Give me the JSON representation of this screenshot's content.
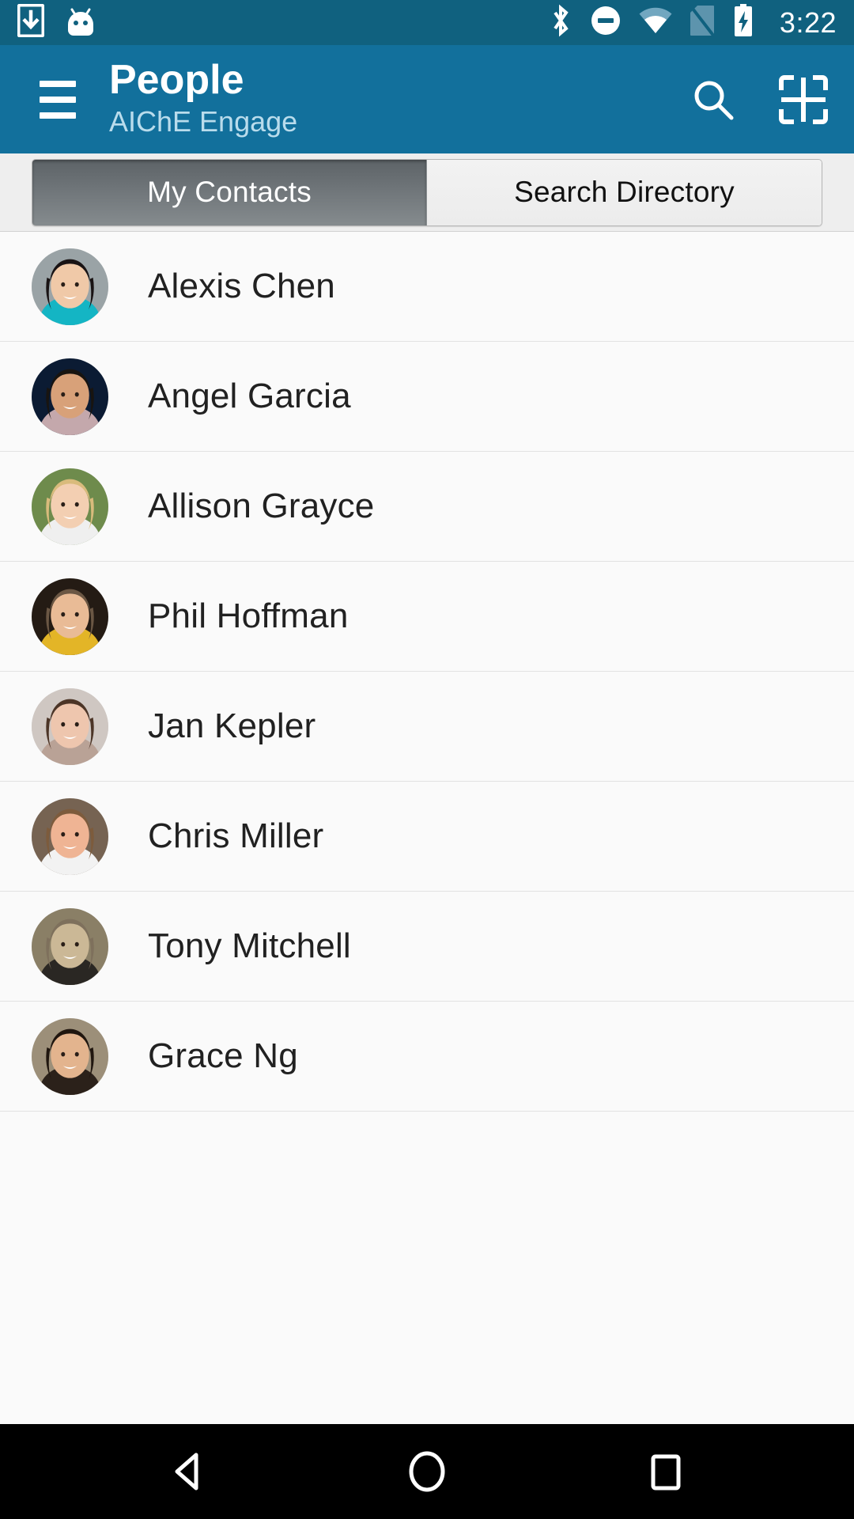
{
  "status_bar": {
    "background_color": "#10617f",
    "time": "3:22",
    "left_icons": [
      {
        "name": "download-icon",
        "glyph": "download"
      },
      {
        "name": "android-head-icon",
        "glyph": "android"
      }
    ],
    "right_icons": [
      {
        "name": "bluetooth-icon",
        "glyph": "bluetooth"
      },
      {
        "name": "do-not-disturb-icon",
        "glyph": "dnd"
      },
      {
        "name": "wifi-icon",
        "glyph": "wifi"
      },
      {
        "name": "no-sim-icon",
        "glyph": "no-sim"
      },
      {
        "name": "battery-charging-icon",
        "glyph": "battery-charging"
      }
    ]
  },
  "app_bar": {
    "background_color": "#12709c",
    "title": "People",
    "subtitle": "AIChE Engage",
    "menu_icon": "hamburger-menu-icon",
    "actions": [
      {
        "name": "search-icon",
        "label": "Search"
      },
      {
        "name": "grid-view-icon",
        "label": "Grid"
      }
    ]
  },
  "tabs": {
    "selected_index": 0,
    "items": [
      {
        "label": "My Contacts",
        "selected": true
      },
      {
        "label": "Search Directory",
        "selected": false
      }
    ]
  },
  "contacts": [
    {
      "name": "Alexis Chen",
      "avatar_skin": "#f0c9a8",
      "avatar_hair": "#191314",
      "avatar_bg": "#9aa3a6",
      "avatar_shirt": "#14b5c4"
    },
    {
      "name": "Angel Garcia",
      "avatar_skin": "#d8a179",
      "avatar_hair": "#181410",
      "avatar_bg": "#0b1b33",
      "avatar_shirt": "#c4a8ac"
    },
    {
      "name": "Allison Grayce",
      "avatar_skin": "#f3cfb2",
      "avatar_hair": "#d9bb7c",
      "avatar_bg": "#6e8b4c",
      "avatar_shirt": "#efefef"
    },
    {
      "name": "Phil Hoffman",
      "avatar_skin": "#e9bb96",
      "avatar_hair": "#6b5744",
      "avatar_bg": "#241b14",
      "avatar_shirt": "#e3b527"
    },
    {
      "name": "Jan Kepler",
      "avatar_skin": "#eec6ae",
      "avatar_hair": "#4c3527",
      "avatar_bg": "#cfc7c2",
      "avatar_shirt": "#b9a296"
    },
    {
      "name": "Chris Miller",
      "avatar_skin": "#efb494",
      "avatar_hair": "#7d5b3c",
      "avatar_bg": "#766352",
      "avatar_shirt": "#f2f2f2"
    },
    {
      "name": "Tony Mitchell",
      "avatar_skin": "#cbb896",
      "avatar_hair": "#7e705c",
      "avatar_bg": "#8a7f66",
      "avatar_shirt": "#2a2723"
    },
    {
      "name": "Grace Ng",
      "avatar_skin": "#e3b48e",
      "avatar_hair": "#20160f",
      "avatar_bg": "#9c8f79",
      "avatar_shirt": "#2b211a"
    }
  ],
  "nav_bar": {
    "background_color": "#000000",
    "buttons": [
      {
        "name": "back-button",
        "glyph": "triangle-left"
      },
      {
        "name": "home-button",
        "glyph": "circle"
      },
      {
        "name": "recents-button",
        "glyph": "square"
      }
    ]
  }
}
